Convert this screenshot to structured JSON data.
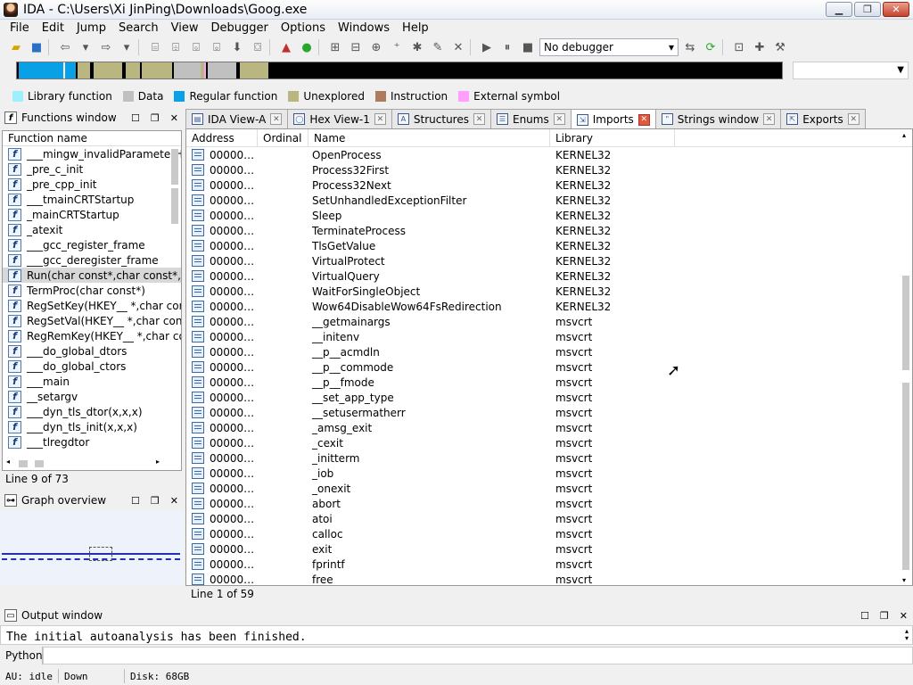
{
  "window": {
    "title": "IDA - C:\\Users\\Xi JinPing\\Downloads\\Goog.exe",
    "min": "▁",
    "max": "❐",
    "close": "✕"
  },
  "menu": [
    "File",
    "Edit",
    "Jump",
    "Search",
    "View",
    "Debugger",
    "Options",
    "Windows",
    "Help"
  ],
  "toolbar": {
    "debugger_select": "No debugger"
  },
  "legend": [
    {
      "label": "Library function",
      "color": "#9ff0ff"
    },
    {
      "label": "Data",
      "color": "#c0c0c0"
    },
    {
      "label": "Regular function",
      "color": "#0aa0e6"
    },
    {
      "label": "Unexplored",
      "color": "#b9b77f"
    },
    {
      "label": "Instruction",
      "color": "#b07a5f"
    },
    {
      "label": "External symbol",
      "color": "#ffa0ff"
    }
  ],
  "functions_window": {
    "title": "Functions window",
    "column": "Function name",
    "items": [
      "___mingw_invalidParameterHandler",
      "_pre_c_init",
      "_pre_cpp_init",
      "___tmainCRTStartup",
      "_mainCRTStartup",
      "_atexit",
      "___gcc_register_frame",
      "___gcc_deregister_frame",
      "Run(char const*,char const*,char const*)",
      "TermProc(char const*)",
      "RegSetKey(HKEY__ *,char const*)",
      "RegSetVal(HKEY__ *,char const*)",
      "RegRemKey(HKEY__ *,char const*)",
      "___do_global_dtors",
      "___do_global_ctors",
      "___main",
      "__setargv",
      "___dyn_tls_dtor(x,x,x)",
      "___dyn_tls_init(x,x,x)",
      "___tlregdtor"
    ],
    "selected_index": 8,
    "status": "Line 9 of 73"
  },
  "graph_overview": {
    "title": "Graph overview"
  },
  "tabs": [
    {
      "label": "IDA View-A",
      "icon": "ida-view-icon",
      "active": false
    },
    {
      "label": "Hex View-1",
      "icon": "hex-view-icon",
      "active": false
    },
    {
      "label": "Structures",
      "icon": "structures-icon",
      "active": false
    },
    {
      "label": "Enums",
      "icon": "enums-icon",
      "active": false
    },
    {
      "label": "Imports",
      "icon": "imports-icon",
      "active": true
    },
    {
      "label": "Strings window",
      "icon": "strings-icon",
      "active": false
    },
    {
      "label": "Exports",
      "icon": "exports-icon",
      "active": false
    }
  ],
  "imports": {
    "columns": [
      "Address",
      "Ordinal",
      "Name",
      "Library"
    ],
    "rows": [
      {
        "address": "00000…",
        "ordinal": "",
        "name": "OpenProcess",
        "library": "KERNEL32"
      },
      {
        "address": "00000…",
        "ordinal": "",
        "name": "Process32First",
        "library": "KERNEL32"
      },
      {
        "address": "00000…",
        "ordinal": "",
        "name": "Process32Next",
        "library": "KERNEL32"
      },
      {
        "address": "00000…",
        "ordinal": "",
        "name": "SetUnhandledExceptionFilter",
        "library": "KERNEL32"
      },
      {
        "address": "00000…",
        "ordinal": "",
        "name": "Sleep",
        "library": "KERNEL32"
      },
      {
        "address": "00000…",
        "ordinal": "",
        "name": "TerminateProcess",
        "library": "KERNEL32"
      },
      {
        "address": "00000…",
        "ordinal": "",
        "name": "TlsGetValue",
        "library": "KERNEL32"
      },
      {
        "address": "00000…",
        "ordinal": "",
        "name": "VirtualProtect",
        "library": "KERNEL32"
      },
      {
        "address": "00000…",
        "ordinal": "",
        "name": "VirtualQuery",
        "library": "KERNEL32"
      },
      {
        "address": "00000…",
        "ordinal": "",
        "name": "WaitForSingleObject",
        "library": "KERNEL32"
      },
      {
        "address": "00000…",
        "ordinal": "",
        "name": "Wow64DisableWow64FsRedirection",
        "library": "KERNEL32"
      },
      {
        "address": "00000…",
        "ordinal": "",
        "name": "__getmainargs",
        "library": "msvcrt"
      },
      {
        "address": "00000…",
        "ordinal": "",
        "name": "__initenv",
        "library": "msvcrt"
      },
      {
        "address": "00000…",
        "ordinal": "",
        "name": "__p__acmdln",
        "library": "msvcrt"
      },
      {
        "address": "00000…",
        "ordinal": "",
        "name": "__p__commode",
        "library": "msvcrt"
      },
      {
        "address": "00000…",
        "ordinal": "",
        "name": "__p__fmode",
        "library": "msvcrt"
      },
      {
        "address": "00000…",
        "ordinal": "",
        "name": "__set_app_type",
        "library": "msvcrt"
      },
      {
        "address": "00000…",
        "ordinal": "",
        "name": "__setusermatherr",
        "library": "msvcrt"
      },
      {
        "address": "00000…",
        "ordinal": "",
        "name": "_amsg_exit",
        "library": "msvcrt"
      },
      {
        "address": "00000…",
        "ordinal": "",
        "name": "_cexit",
        "library": "msvcrt"
      },
      {
        "address": "00000…",
        "ordinal": "",
        "name": "_initterm",
        "library": "msvcrt"
      },
      {
        "address": "00000…",
        "ordinal": "",
        "name": "_iob",
        "library": "msvcrt"
      },
      {
        "address": "00000…",
        "ordinal": "",
        "name": "_onexit",
        "library": "msvcrt"
      },
      {
        "address": "00000…",
        "ordinal": "",
        "name": "abort",
        "library": "msvcrt"
      },
      {
        "address": "00000…",
        "ordinal": "",
        "name": "atoi",
        "library": "msvcrt"
      },
      {
        "address": "00000…",
        "ordinal": "",
        "name": "calloc",
        "library": "msvcrt"
      },
      {
        "address": "00000…",
        "ordinal": "",
        "name": "exit",
        "library": "msvcrt"
      },
      {
        "address": "00000…",
        "ordinal": "",
        "name": "fprintf",
        "library": "msvcrt"
      },
      {
        "address": "00000…",
        "ordinal": "",
        "name": "free",
        "library": "msvcrt"
      }
    ],
    "status": "Line 1 of 59"
  },
  "output_window": {
    "title": "Output window",
    "text": "The initial autoanalysis has been finished."
  },
  "python": {
    "label": "Python"
  },
  "statusbar": {
    "au": "AU:  idle",
    "direction": "Down",
    "disk": "Disk: 68GB"
  }
}
